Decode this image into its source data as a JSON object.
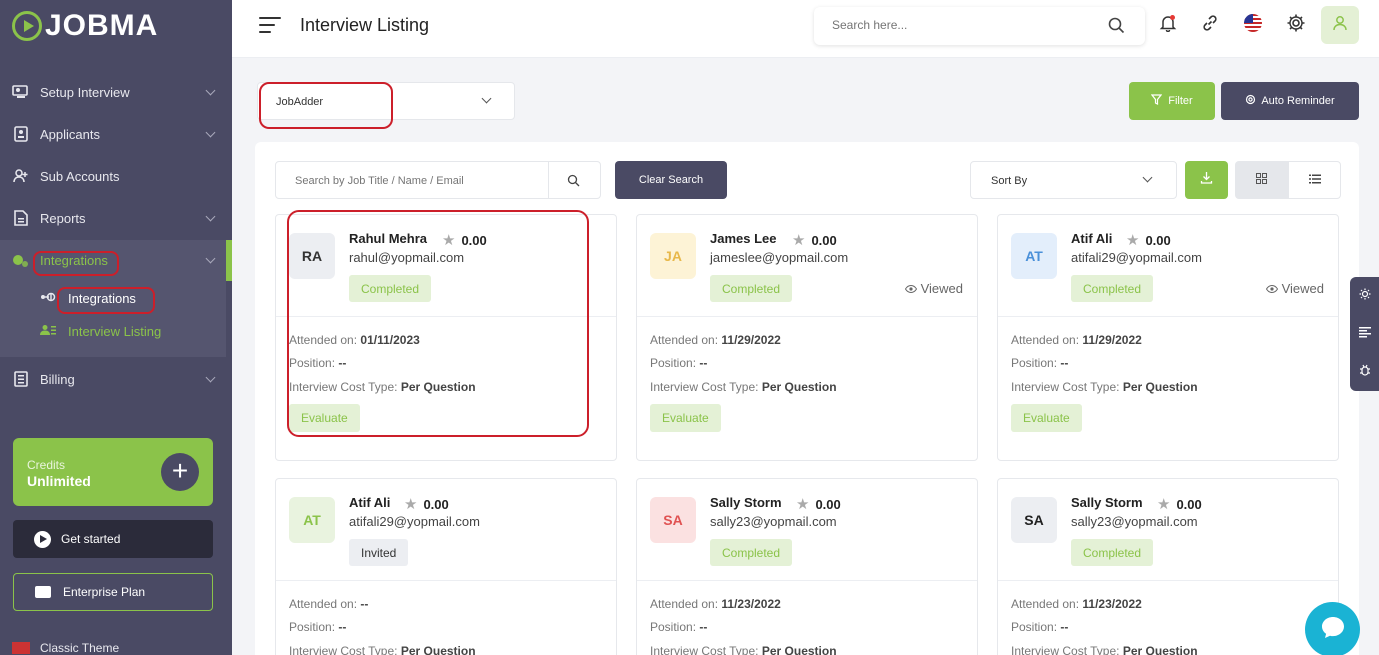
{
  "brand": {
    "name": "JOBMA",
    "accent": "#8bc34a",
    "sidebar_bg": "#4a4a64"
  },
  "sidebar": {
    "items": [
      {
        "label": "Setup Interview",
        "icon": "setup-interview-icon"
      },
      {
        "label": "Applicants",
        "icon": "applicants-icon"
      },
      {
        "label": "Sub Accounts",
        "icon": "sub-accounts-icon"
      },
      {
        "label": "Reports",
        "icon": "reports-icon"
      },
      {
        "label": "Integrations",
        "icon": "integrations-icon",
        "active": true
      },
      {
        "label": "Billing",
        "icon": "billing-icon"
      }
    ],
    "sub_items": [
      {
        "label": "Integrations",
        "icon": "plug-icon"
      },
      {
        "label": "Interview Listing",
        "icon": "users-list-icon",
        "active": true
      }
    ],
    "credits_label": "Credits",
    "credits_value": "Unlimited",
    "get_started": "Get started",
    "enterprise": "Enterprise Plan",
    "classic_theme": "Classic Theme"
  },
  "header": {
    "title": "Interview Listing",
    "search_placeholder": "Search here...",
    "icons": [
      "bell-icon",
      "link-icon",
      "us-flag-icon",
      "gear-icon",
      "profile-icon"
    ]
  },
  "toolbar": {
    "integration_select": "JobAdder",
    "filter_label": "Filter",
    "auto_reminder_label": "Auto Reminder",
    "job_search_placeholder": "Search by Job Title / Name / Email",
    "clear_search_label": "Clear Search",
    "sort_label": "Sort By"
  },
  "cards": [
    {
      "initials": "RA",
      "name": "Rahul Mehra",
      "rating": "0.00",
      "email": "rahul@yopmail.com",
      "status": "Completed",
      "viewed": "",
      "attended_label": "Attended on:",
      "attended": "01/11/2023",
      "position_label": "Position:",
      "position": "--",
      "cost_label": "Interview Cost Type:",
      "cost": "Per Question",
      "action": "Evaluate"
    },
    {
      "initials": "JA",
      "name": "James Lee",
      "rating": "0.00",
      "email": "jameslee@yopmail.com",
      "status": "Completed",
      "viewed": "Viewed",
      "attended_label": "Attended on:",
      "attended": "11/29/2022",
      "position_label": "Position:",
      "position": "--",
      "cost_label": "Interview Cost Type:",
      "cost": "Per Question",
      "action": "Evaluate"
    },
    {
      "initials": "AT",
      "name": "Atif Ali",
      "rating": "0.00",
      "email": "atifali29@yopmail.com",
      "status": "Completed",
      "viewed": "Viewed",
      "attended_label": "Attended on:",
      "attended": "11/29/2022",
      "position_label": "Position:",
      "position": "--",
      "cost_label": "Interview Cost Type:",
      "cost": "Per Question",
      "action": "Evaluate"
    },
    {
      "initials": "AT",
      "name": "Atif Ali",
      "rating": "0.00",
      "email": "atifali29@yopmail.com",
      "status": "Invited",
      "viewed": "",
      "attended_label": "Attended on:",
      "attended": "--",
      "position_label": "Position:",
      "position": "--",
      "cost_label": "Interview Cost Type:",
      "cost": "Per Question",
      "action": ""
    },
    {
      "initials": "SA",
      "name": "Sally Storm",
      "rating": "0.00",
      "email": "sally23@yopmail.com",
      "status": "Completed",
      "viewed": "",
      "attended_label": "Attended on:",
      "attended": "11/23/2022",
      "position_label": "Position:",
      "position": "--",
      "cost_label": "Interview Cost Type:",
      "cost": "Per Question",
      "action": ""
    },
    {
      "initials": "SA",
      "name": "Sally Storm",
      "rating": "0.00",
      "email": "sally23@yopmail.com",
      "status": "Completed",
      "viewed": "",
      "attended_label": "Attended on:",
      "attended": "11/23/2022",
      "position_label": "Position:",
      "position": "--",
      "cost_label": "Interview Cost Type:",
      "cost": "Per Question",
      "action": ""
    }
  ]
}
